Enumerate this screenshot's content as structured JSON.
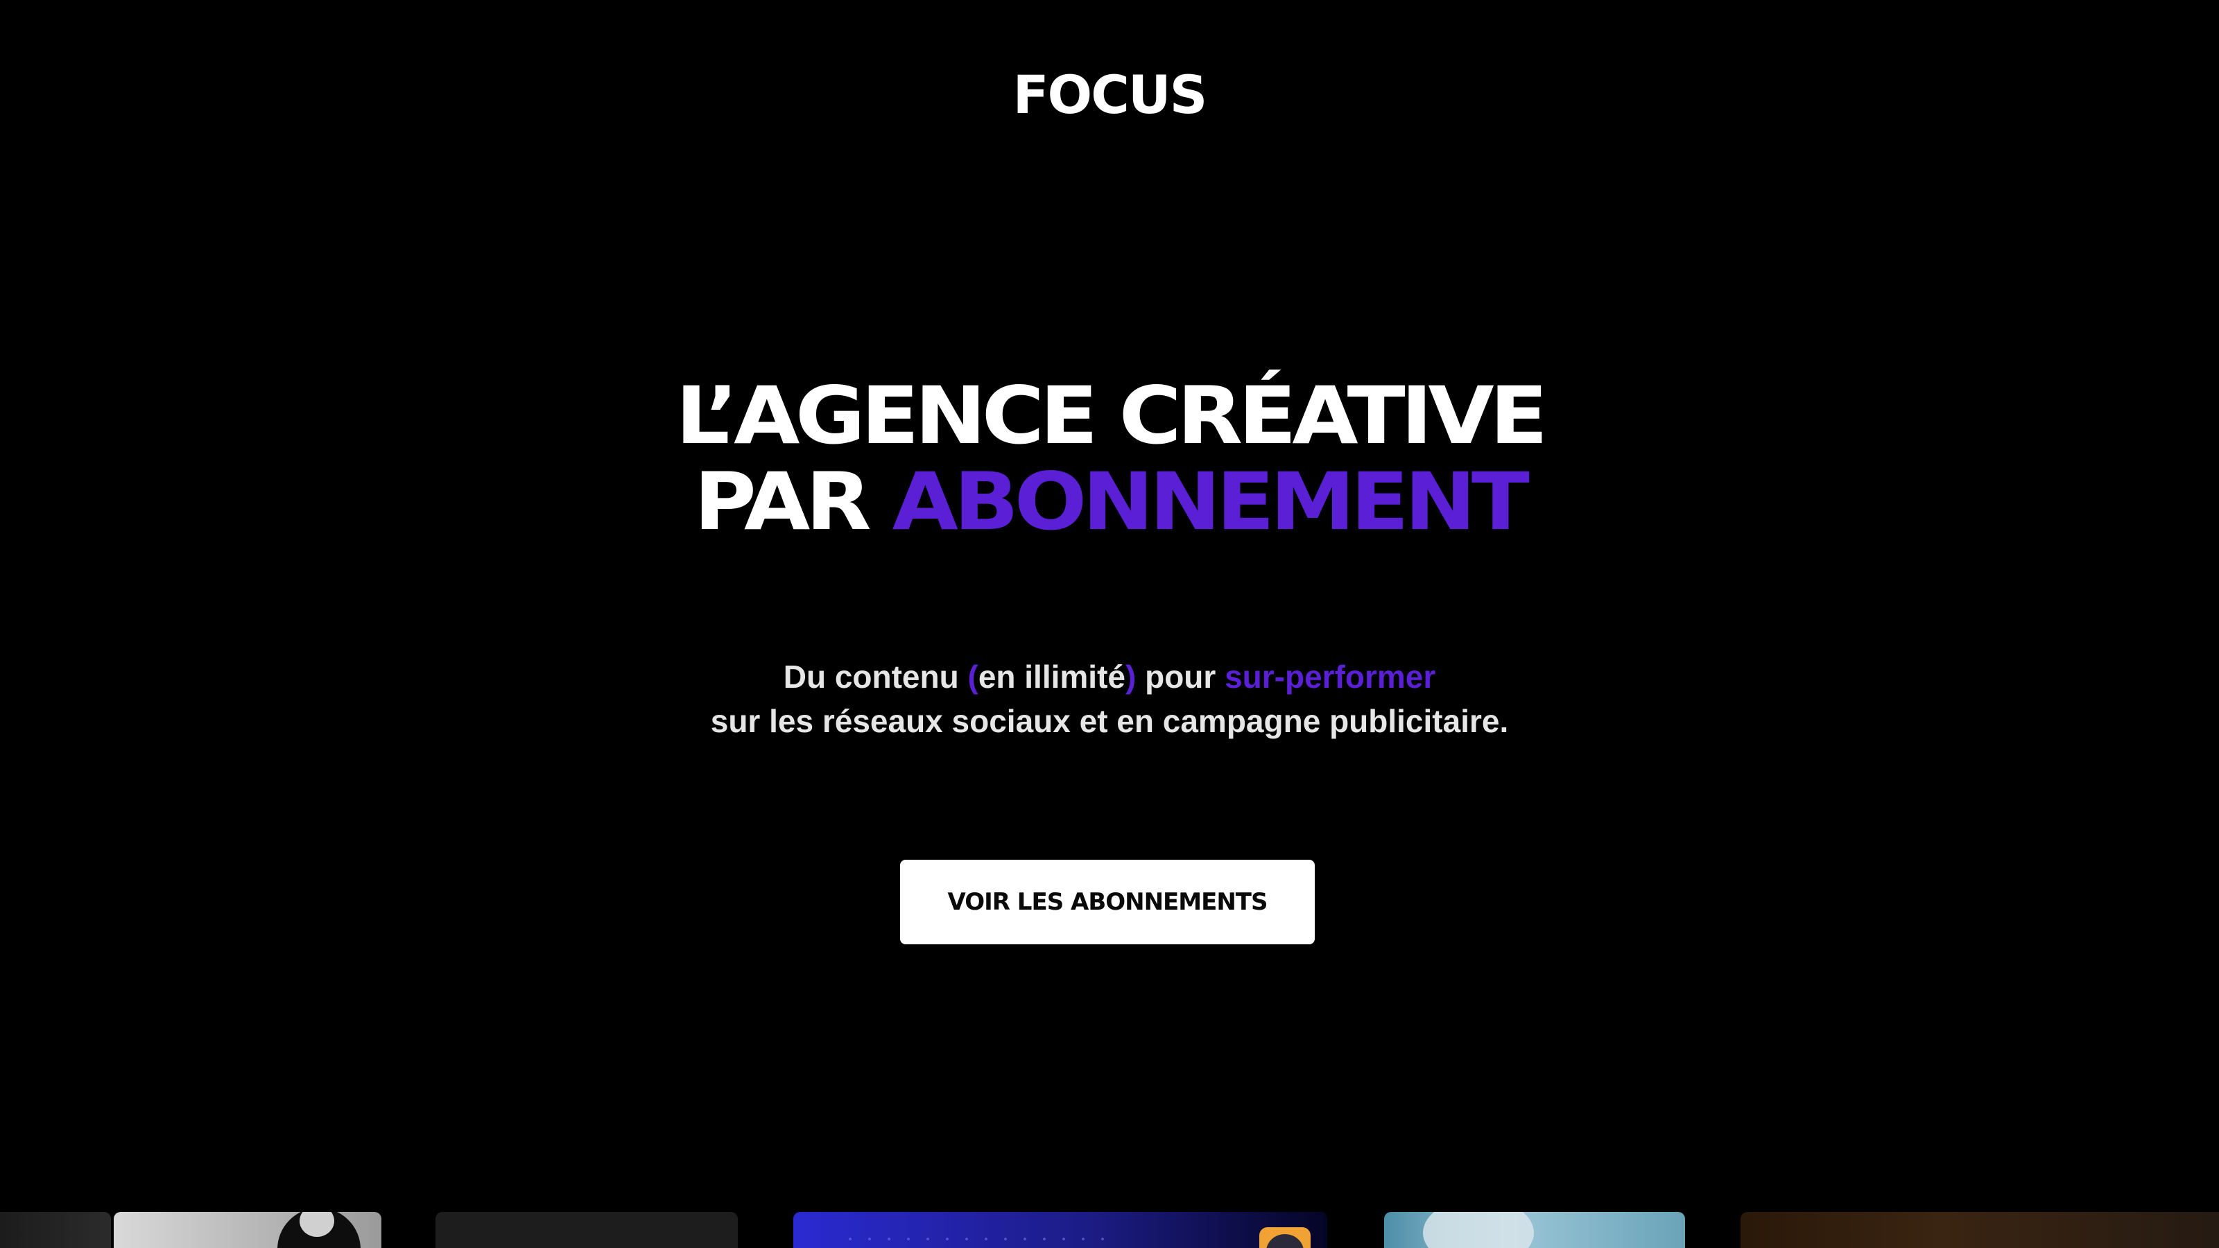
{
  "brand": {
    "logo_text": "FOCUS"
  },
  "hero": {
    "headline_line1": "L’AGENCE CRÉATIVE",
    "headline_line2_prefix": "PAR ",
    "headline_line2_accent": "ABONNEMENT",
    "subtitle": {
      "part1": "Du contenu ",
      "paren_open": "(",
      "paren_text": "en illimité",
      "paren_close": ")",
      "part2": " pour ",
      "accent": "sur-performer",
      "line2": "sur les réseaux sociaux et en campagne publicitaire."
    },
    "cta_label": "VOIR LES ABONNEMENTS"
  },
  "colors": {
    "background": "#000000",
    "accent": "#5b1fd6",
    "text": "#ffffff",
    "button_bg": "#ffffff",
    "button_text": "#0a0a0a"
  },
  "portfolio_strip": {
    "items": [
      {
        "name": "portfolio-card-1"
      },
      {
        "name": "portfolio-card-2"
      },
      {
        "name": "portfolio-card-3"
      },
      {
        "name": "portfolio-card-4"
      },
      {
        "name": "portfolio-card-5"
      },
      {
        "name": "portfolio-card-6"
      }
    ]
  }
}
